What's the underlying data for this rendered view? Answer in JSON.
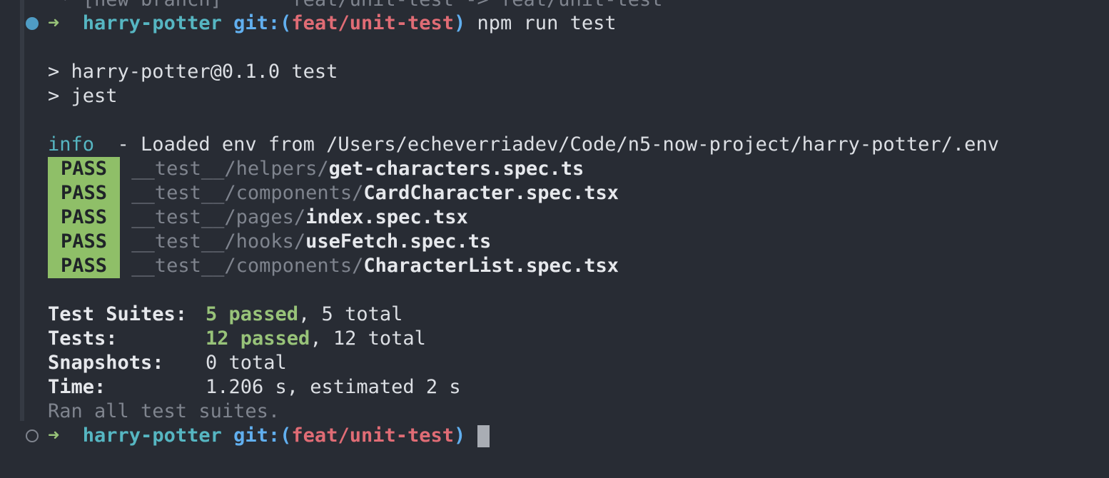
{
  "terminal": {
    "top_fragment": " * [new branch]      feat/unit-test -> feat/unit-test",
    "prompt1": {
      "arrow": "➜",
      "dir": "harry-potter",
      "git_label": "git:",
      "paren_open": "(",
      "branch": "feat/unit-test",
      "paren_close": ")",
      "command": "npm run test"
    },
    "script_lines": [
      "> harry-potter@0.1.0 test",
      "> jest"
    ],
    "info": {
      "tag": "info",
      "message": "  - Loaded env from /Users/echeverriadev/Code/n5-now-project/harry-potter/.env"
    },
    "results": [
      {
        "status": "PASS",
        "dir": "__test__/helpers/",
        "file": "get-characters.spec.ts"
      },
      {
        "status": "PASS",
        "dir": "__test__/components/",
        "file": "CardCharacter.spec.tsx"
      },
      {
        "status": "PASS",
        "dir": "__test__/pages/",
        "file": "index.spec.tsx"
      },
      {
        "status": "PASS",
        "dir": "__test__/hooks/",
        "file": "useFetch.spec.ts"
      },
      {
        "status": "PASS",
        "dir": "__test__/components/",
        "file": "CharacterList.spec.tsx"
      }
    ],
    "summary": {
      "suites": {
        "label": "Test Suites:",
        "passed": "5 passed",
        "rest": ", 5 total"
      },
      "tests": {
        "label": "Tests:",
        "passed": "12 passed",
        "rest": ", 12 total"
      },
      "snapshots": {
        "label": "Snapshots:",
        "value": "0 total"
      },
      "time": {
        "label": "Time:",
        "value": "1.206 s, estimated 2 s"
      }
    },
    "ran_all": "Ran all test suites.",
    "prompt2": {
      "arrow": "➜",
      "dir": "harry-potter",
      "git_label": "git:",
      "paren_open": "(",
      "branch": "feat/unit-test",
      "paren_close": ")"
    },
    "colors": {
      "background": "#282c34",
      "pass_badge": "#8fbf68",
      "passed_text": "#98c379",
      "branch": "#e06c75",
      "dir": "#56b6c2",
      "git": "#61afef"
    }
  }
}
